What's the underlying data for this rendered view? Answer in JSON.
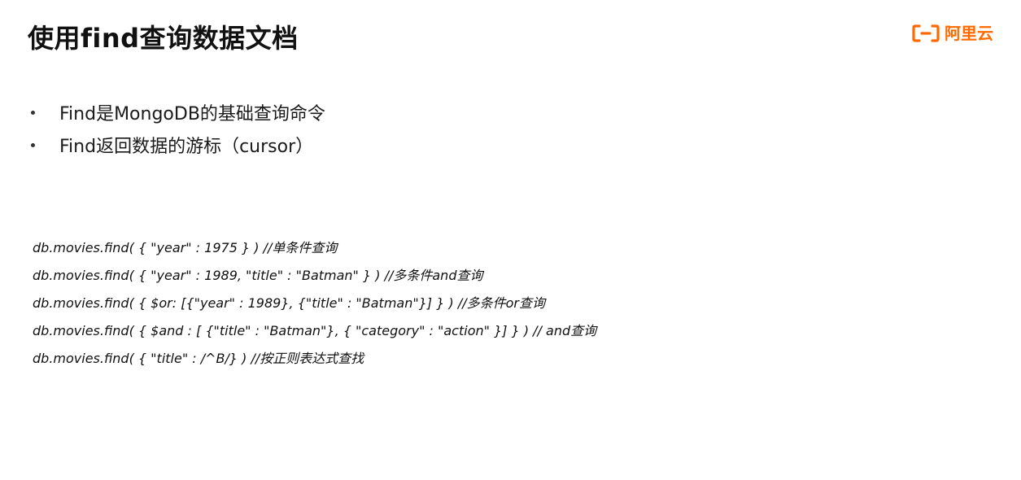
{
  "slide": {
    "title": "使用find查询数据文档",
    "logo": {
      "text": "阿里云",
      "icon": "aliyun-logo-icon",
      "color": "#ff6a00"
    },
    "bullets": [
      "Find是MongoDB的基础查询命令",
      "Find返回数据的游标（cursor）"
    ],
    "code_lines": [
      "db.movies.find( { \"year\" : 1975 } ) //单条件查询",
      "db.movies.find( { \"year\" : 1989, \"title\" : \"Batman\" } ) //多条件and查询",
      "db.movies.find( { $or: [{\"year\" : 1989}, {\"title\" : \"Batman\"}] } ) //多条件or查询",
      "db.movies.find( { $and : [ {\"title\" : \"Batman\"}, { \"category\" : \"action\" }] } ) // and查询",
      "db.movies.find( { \"title\" : /^B/} ) //按正则表达式查找"
    ]
  }
}
